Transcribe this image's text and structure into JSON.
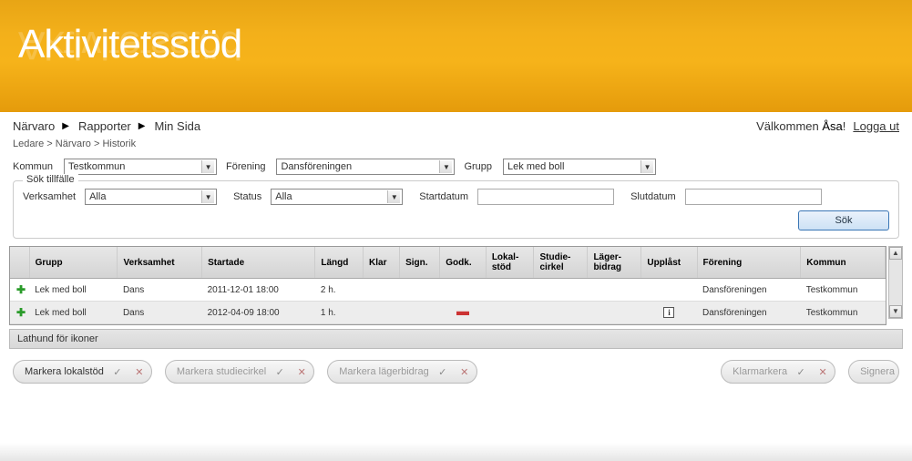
{
  "version": "1.7.0.0",
  "app_title": "Aktivitetsstöd",
  "nav": {
    "items": [
      "Närvaro",
      "Rapporter",
      "Min Sida"
    ]
  },
  "welcome": {
    "prefix": "Välkommen ",
    "user": "Åsa",
    "logout": "Logga ut"
  },
  "breadcrumb": "Ledare > Närvaro > Historik",
  "filters": {
    "kommun_label": "Kommun",
    "kommun_value": "Testkommun",
    "forening_label": "Förening",
    "forening_value": "Dansföreningen",
    "grupp_label": "Grupp",
    "grupp_value": "Lek med boll"
  },
  "search_box": {
    "legend": "Sök tillfälle",
    "verksamhet_label": "Verksamhet",
    "verksamhet_value": "Alla",
    "status_label": "Status",
    "status_value": "Alla",
    "start_label": "Startdatum",
    "start_value": "",
    "slut_label": "Slutdatum",
    "slut_value": "",
    "button": "Sök"
  },
  "table": {
    "headers": {
      "grupp": "Grupp",
      "verksamhet": "Verksamhet",
      "startade": "Startade",
      "langd": "Längd",
      "klar": "Klar",
      "sign": "Sign.",
      "godk": "Godk.",
      "lokalstod": "Lokal-\nstöd",
      "studiecirkel": "Studie-\ncirkel",
      "lagerbidrag": "Läger-\nbidrag",
      "upplast": "Upplåst",
      "forening": "Förening",
      "kommun": "Kommun"
    },
    "rows": [
      {
        "grupp": "Lek med boll",
        "verksamhet": "Dans",
        "startade": "2011-12-01 18:00",
        "langd": "2 h.",
        "godk_minus": false,
        "upplast_info": false,
        "forening": "Dansföreningen",
        "kommun": "Testkommun"
      },
      {
        "grupp": "Lek med boll",
        "verksamhet": "Dans",
        "startade": "2012-04-09 18:00",
        "langd": "1 h.",
        "godk_minus": true,
        "upplast_info": true,
        "forening": "Dansföreningen",
        "kommun": "Testkommun"
      }
    ]
  },
  "icon_legend": "Lathund för ikoner",
  "actions": {
    "lokalstod": "Markera lokalstöd",
    "studiecirkel": "Markera studiecirkel",
    "lagerbidrag": "Markera lägerbidrag",
    "klarmarkera": "Klarmarkera",
    "signera": "Signera"
  }
}
